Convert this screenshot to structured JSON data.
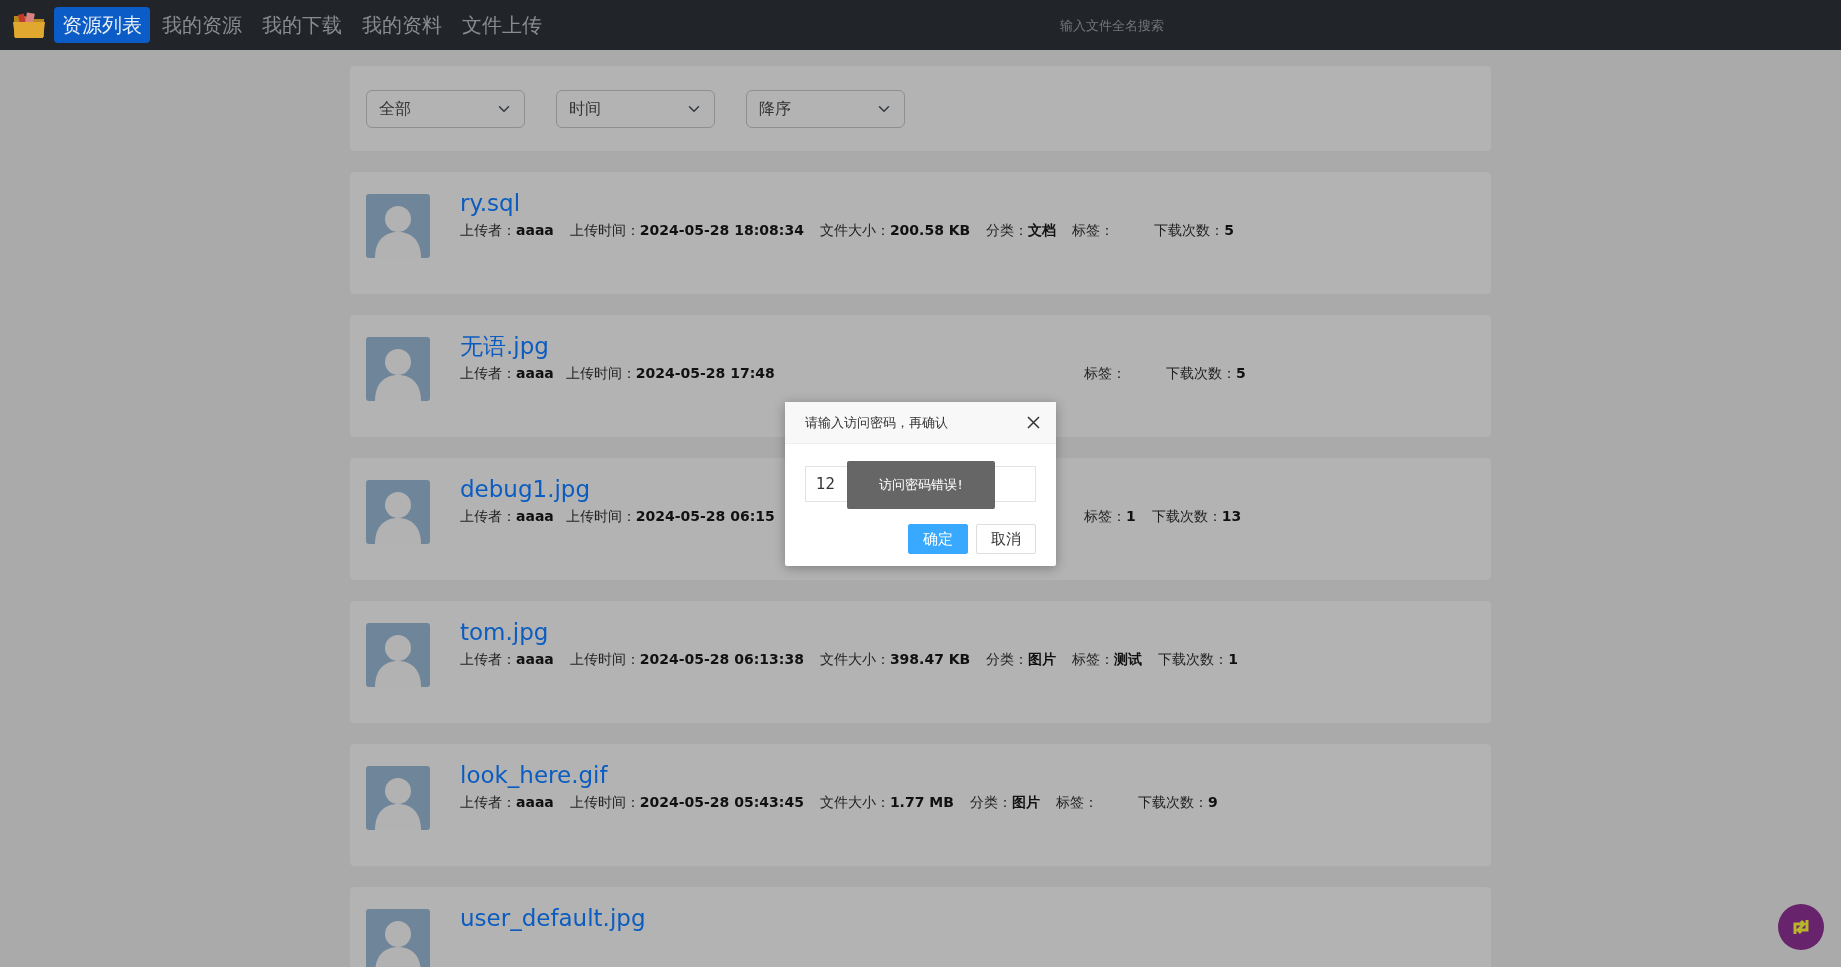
{
  "navbar": {
    "tabs": [
      {
        "label": "资源列表",
        "selected": true
      },
      {
        "label": "我的资源",
        "selected": false
      },
      {
        "label": "我的下载",
        "selected": false
      },
      {
        "label": "我的资料",
        "selected": false
      },
      {
        "label": "文件上传",
        "selected": false
      }
    ],
    "search": {
      "placeholder": "输入文件全名搜索"
    }
  },
  "filters": [
    {
      "value": "全部"
    },
    {
      "value": "时间"
    },
    {
      "value": "降序"
    }
  ],
  "files": [
    {
      "name": "ry.sql",
      "fields": [
        {
          "label": "上传者：",
          "value": "aaaa"
        },
        {
          "label": "上传时间：",
          "value": "2024-05-28 18:08:34"
        },
        {
          "label": "文件大小：",
          "value": "200.58 KB"
        },
        {
          "label": "分类：",
          "value": "文档"
        },
        {
          "label": "标签："
        },
        {
          "label": "下载次数：",
          "value": "5"
        }
      ]
    },
    {
      "name": "无语.jpg",
      "fields": [
        {
          "label": "上传者：",
          "value": "aaaa"
        },
        {
          "label": "上传时间：",
          "value": "2024-05-28 17:48"
        }
      ],
      "fields_right": [
        {
          "label": "标签："
        },
        {
          "label": "下载次数：",
          "value": "5"
        }
      ]
    },
    {
      "name": "debug1.jpg",
      "fields": [
        {
          "label": "上传者：",
          "value": "aaaa"
        },
        {
          "label": "上传时间：",
          "value": "2024-05-28 06:15"
        }
      ],
      "fields_right": [
        {
          "label": "标签：",
          "value": "1"
        },
        {
          "label": "下载次数：",
          "value": "13"
        }
      ]
    },
    {
      "name": "tom.jpg",
      "fields": [
        {
          "label": "上传者：",
          "value": "aaaa"
        },
        {
          "label": "上传时间：",
          "value": "2024-05-28 06:13:38"
        },
        {
          "label": "文件大小：",
          "value": "398.47 KB"
        },
        {
          "label": "分类：",
          "value": "图片"
        },
        {
          "label": "标签：",
          "value": "测试"
        },
        {
          "label": "下载次数：",
          "value": "1"
        }
      ]
    },
    {
      "name": "look_here.gif",
      "fields": [
        {
          "label": "上传者：",
          "value": "aaaa"
        },
        {
          "label": "上传时间：",
          "value": "2024-05-28 05:43:45"
        },
        {
          "label": "文件大小：",
          "value": "1.77 MB"
        },
        {
          "label": "分类：",
          "value": "图片"
        },
        {
          "label": "标签："
        },
        {
          "label": "下载次数：",
          "value": "9"
        }
      ]
    },
    {
      "name": "user_default.jpg"
    }
  ],
  "dialog": {
    "title": "请输入访问密码，再确认",
    "password": "12",
    "toast": "访问密码错误!",
    "buttons": [
      {
        "label": "确定",
        "kind": "primary"
      },
      {
        "label": "取消",
        "kind": "secondary"
      }
    ]
  }
}
